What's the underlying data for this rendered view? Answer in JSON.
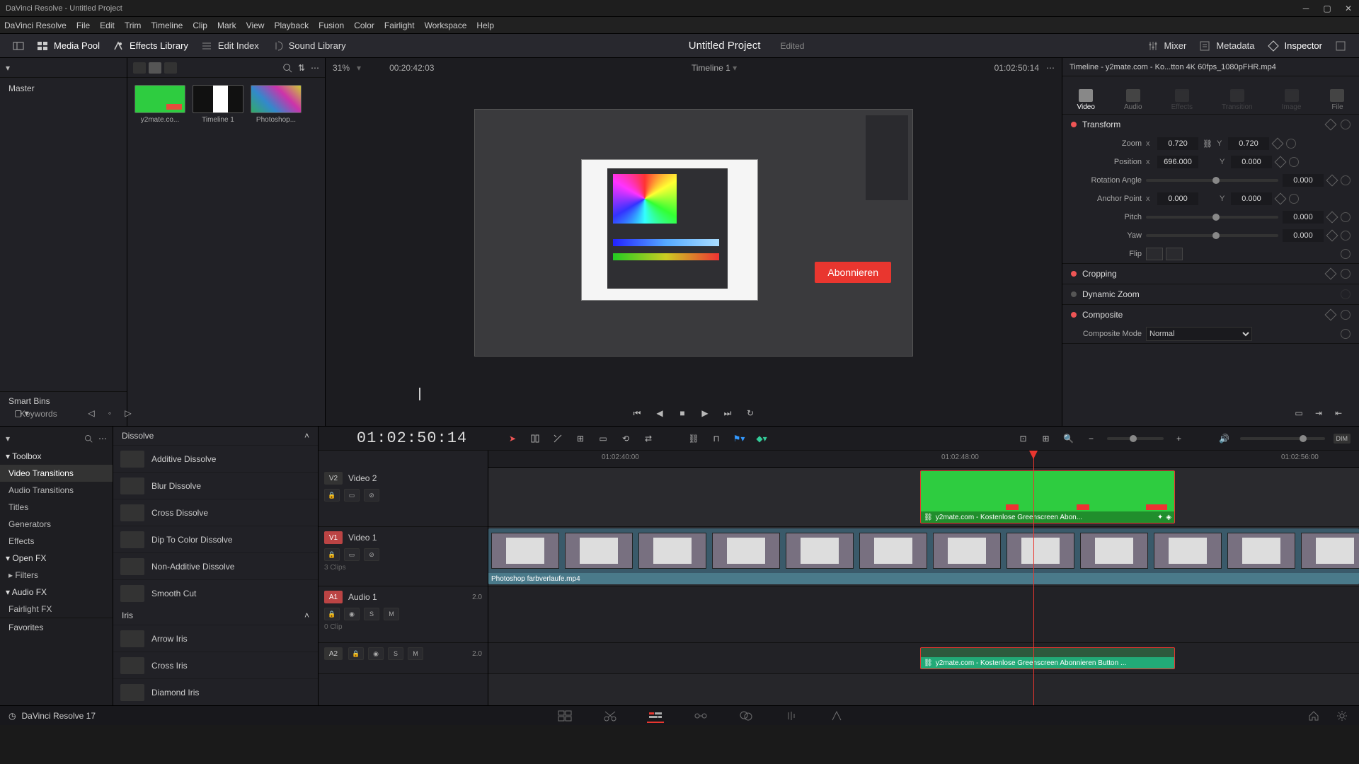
{
  "window": {
    "title": "DaVinci Resolve - Untitled Project"
  },
  "menu": [
    "DaVinci Resolve",
    "File",
    "Edit",
    "Trim",
    "Timeline",
    "Clip",
    "Mark",
    "View",
    "Playback",
    "Fusion",
    "Color",
    "Fairlight",
    "Workspace",
    "Help"
  ],
  "toolbar": {
    "media_pool": "Media Pool",
    "effects_library": "Effects Library",
    "edit_index": "Edit Index",
    "sound_library": "Sound Library",
    "mixer": "Mixer",
    "metadata": "Metadata",
    "inspector": "Inspector"
  },
  "project": {
    "name": "Untitled Project",
    "status": "Edited"
  },
  "viewer": {
    "zoom": "31%",
    "tc_left": "00:20:42:03",
    "timeline_name": "Timeline 1",
    "tc_right": "01:02:50:14",
    "overlay_button": "Abonnieren"
  },
  "media": {
    "master": "Master",
    "thumbs": [
      {
        "label": "y2mate.co...",
        "kind": "green"
      },
      {
        "label": "Timeline 1",
        "kind": "tl"
      },
      {
        "label": "Photoshop...",
        "kind": "ps"
      }
    ],
    "smartbins": "Smart Bins",
    "keywords": "Keywords"
  },
  "fx_tree": {
    "toolbox": "Toolbox",
    "items": [
      "Video Transitions",
      "Audio Transitions",
      "Titles",
      "Generators",
      "Effects"
    ],
    "openfx": "Open FX",
    "filters": "Filters",
    "audiofx": "Audio FX",
    "fairlightfx": "Fairlight FX",
    "favorites": "Favorites"
  },
  "fx_list": {
    "cat1": "Dissolve",
    "entries1": [
      "Additive Dissolve",
      "Blur Dissolve",
      "Cross Dissolve",
      "Dip To Color Dissolve",
      "Non-Additive Dissolve",
      "Smooth Cut"
    ],
    "cat2": "Iris",
    "entries2": [
      "Arrow Iris",
      "Cross Iris",
      "Diamond Iris"
    ]
  },
  "inspector_panel": {
    "title": "Timeline - y2mate.com - Ko...tton 4K 60fps_1080pFHR.mp4",
    "tabs": [
      "Video",
      "Audio",
      "Effects",
      "Transition",
      "Image",
      "File"
    ],
    "transform": "Transform",
    "zoom": "Zoom",
    "zoom_x": "0.720",
    "zoom_y": "0.720",
    "position": "Position",
    "pos_x": "696.000",
    "pos_y": "0.000",
    "rotation": "Rotation Angle",
    "rot_v": "0.000",
    "anchor": "Anchor Point",
    "anc_x": "0.000",
    "anc_y": "0.000",
    "pitch": "Pitch",
    "pitch_v": "0.000",
    "yaw": "Yaw",
    "yaw_v": "0.000",
    "flip": "Flip",
    "cropping": "Cropping",
    "dynzoom": "Dynamic Zoom",
    "composite": "Composite",
    "compmode": "Composite Mode",
    "compmode_v": "Normal"
  },
  "timeline": {
    "tc": "01:02:50:14",
    "ticks": [
      "01:02:40:00",
      "01:02:48:00",
      "01:02:56:00"
    ],
    "tracks": {
      "v2": {
        "label": "Video 2",
        "tag": "V2",
        "clips": ""
      },
      "v1": {
        "label": "Video 1",
        "tag": "V1",
        "clips": "3 Clips"
      },
      "a1": {
        "label": "Audio 1",
        "tag": "A1",
        "level": "2.0",
        "clips": "0 Clip"
      },
      "a2": {
        "label": "",
        "tag": "A2",
        "level": "2.0"
      }
    },
    "clip_green": "y2mate.com - Kostenlose Greenscreen Abon...",
    "clip_video1": "Photoshop farbverlaufe.mp4",
    "clip_audio": "y2mate.com - Kostenlose Greenscreen Abonnieren Button ..."
  },
  "footer": {
    "product": "DaVinci Resolve 17"
  }
}
